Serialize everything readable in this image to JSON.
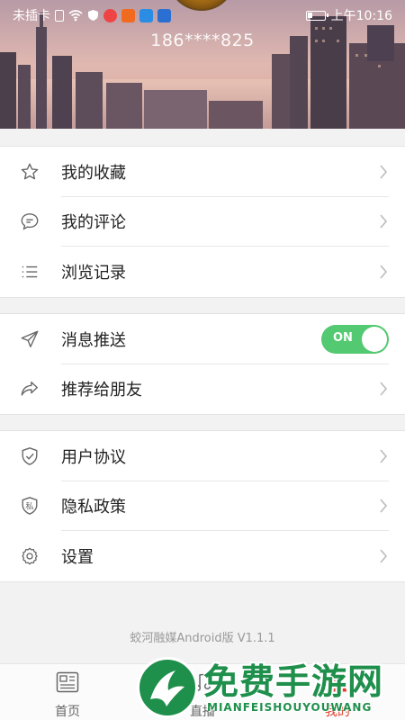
{
  "status_bar": {
    "carrier": "未插卡",
    "time": "上午10:16"
  },
  "profile": {
    "phone": "186****825"
  },
  "menu_groups": [
    {
      "items": [
        {
          "label": "我的收藏",
          "icon": "star-icon"
        },
        {
          "label": "我的评论",
          "icon": "comment-icon"
        },
        {
          "label": "浏览记录",
          "icon": "list-icon"
        }
      ]
    },
    {
      "items": [
        {
          "label": "消息推送",
          "icon": "send-icon",
          "toggle": {
            "state": "ON",
            "on": true
          }
        },
        {
          "label": "推荐给朋友",
          "icon": "share-icon"
        }
      ]
    },
    {
      "items": [
        {
          "label": "用户协议",
          "icon": "shield-check-icon"
        },
        {
          "label": "隐私政策",
          "icon": "privacy-shield-icon",
          "icon_text": "私"
        },
        {
          "label": "设置",
          "icon": "gear-icon"
        }
      ]
    }
  ],
  "version": "蛟河融媒Android版 V1.1.1",
  "tabs": [
    {
      "label": "首页",
      "icon": "news-icon",
      "active": false
    },
    {
      "label": "直播",
      "icon": "music-note-icon",
      "active": false
    },
    {
      "label": "我的",
      "icon": "user-icon",
      "active": true
    }
  ],
  "watermark": {
    "title": "免费手游网",
    "subtitle": "MIANFEISHOUYOUWANG"
  },
  "colors": {
    "toggle_on": "#53c971",
    "active_tab": "#e23d2d",
    "watermark": "#1f8f4c"
  }
}
